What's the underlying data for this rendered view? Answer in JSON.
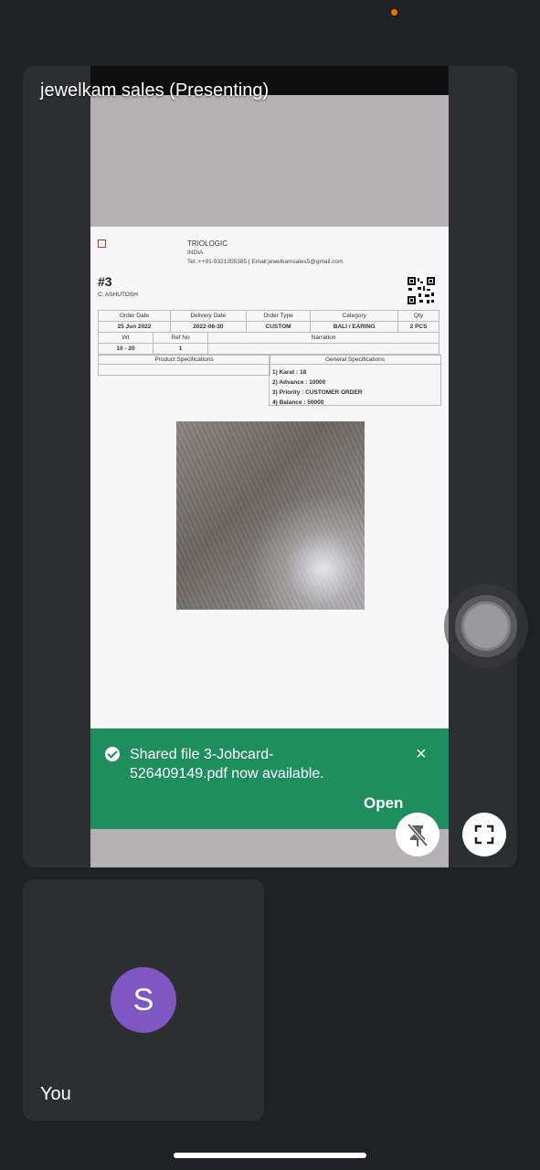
{
  "presenter": {
    "label": "jewelkam sales (Presenting)"
  },
  "document": {
    "company": "TRIOLOGIC",
    "country": "INDIA",
    "contact": "Tel.:++91-9321355385 | Email:jewelkamsales5@gmail.com",
    "order_no": "#3",
    "customer": "C: ASHUTOSH",
    "table1": {
      "headers": [
        "Order Date",
        "Delivery Date",
        "Order Type",
        "Category",
        "Qty"
      ],
      "values": [
        "25 Jun 2022",
        "2022-06-30",
        "CUSTOM",
        "BALI / EARING",
        "2 PCS"
      ]
    },
    "table2": {
      "headers": [
        "Wt",
        "Ref No",
        "Narration"
      ],
      "values": [
        "10 - 20",
        "1",
        ""
      ]
    },
    "product_specs_title": "Product Specifications",
    "general_specs_title": "General Specifications",
    "general_specs": [
      "1) Karat : 18",
      "2) Advance : 10000",
      "3) Priority : CUSTOMER ORDER",
      "4) Balance : 50000"
    ]
  },
  "toast": {
    "message": "Shared file 3-Jobcard-526409149.pdf now available.",
    "close": "×",
    "action": "Open"
  },
  "self": {
    "initial": "S",
    "label": "You"
  },
  "icons": {
    "check": "check-circle-icon",
    "unpin": "unpin-icon",
    "fullscreen": "fullscreen-icon"
  },
  "colors": {
    "toast_green": "#1e8e5e",
    "avatar_purple": "#7e57c2",
    "background": "#202124"
  }
}
